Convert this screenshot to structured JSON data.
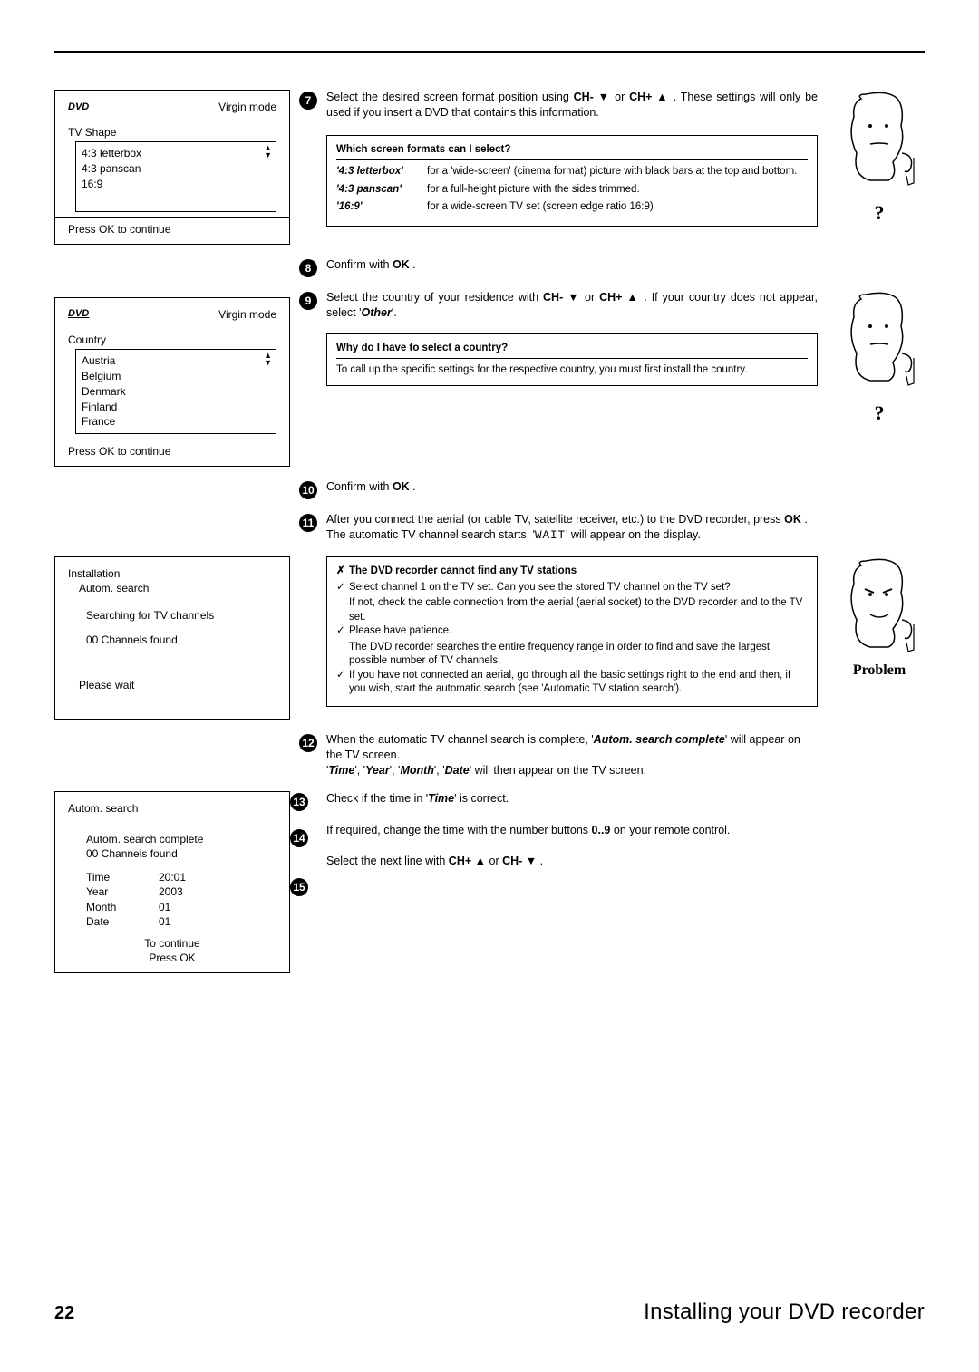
{
  "page_number": "22",
  "section_title": "Installing your DVD recorder",
  "osd1": {
    "mode": "Virgin mode",
    "heading": "TV Shape",
    "options": [
      "4:3 letterbox",
      "4:3 panscan",
      "16:9"
    ],
    "footer": "Press OK to continue"
  },
  "osd2": {
    "mode": "Virgin mode",
    "heading": "Country",
    "options": [
      "Austria",
      "Belgium",
      "Denmark",
      "Finland",
      "France"
    ],
    "footer": "Press OK to continue"
  },
  "osd3": {
    "title": "Installation",
    "subtitle": "Autom. search",
    "line1": "Searching for TV channels",
    "line2": "00 Channels found",
    "line3": "Please wait"
  },
  "osd4": {
    "title": "Autom. search",
    "line1": "Autom. search complete",
    "line2": "00 Channels found",
    "kv": [
      {
        "k": "Time",
        "v": "20:01"
      },
      {
        "k": "Year",
        "v": "2003"
      },
      {
        "k": "Month",
        "v": "01"
      },
      {
        "k": "Date",
        "v": "01"
      }
    ],
    "footer1": "To continue",
    "footer2": "Press OK"
  },
  "step7": {
    "num": "7",
    "text_a": "Select the desired screen format position using ",
    "btn_chm": "CH-",
    "or": " or ",
    "btn_chp": "CH+",
    "text_b": " . These settings will only be used if you insert a DVD that contains this information."
  },
  "info_formats": {
    "title": "Which screen formats can I select?",
    "rows": [
      {
        "term": "4:3 letterbox",
        "desc": "for a 'wide-screen' (cinema format) picture with black bars at the top and bottom."
      },
      {
        "term": "4:3 panscan",
        "desc": "for a full-height picture with the sides trimmed."
      },
      {
        "term": "16:9",
        "desc": "for a wide-screen TV set (screen edge ratio 16:9)"
      }
    ]
  },
  "step8": {
    "num": "8",
    "text_a": "Confirm with ",
    "btn": "OK",
    "text_b": " ."
  },
  "step9": {
    "num": "9",
    "text_a": "Select the country of your residence with ",
    "btn_chm": "CH-",
    "or": " or ",
    "btn_chp": "CH+",
    "text_b": " . If your country does not appear, select '",
    "other": "Other",
    "text_c": "'."
  },
  "info_country": {
    "title": "Why do I have to select a country?",
    "body": "To call up the specific settings for the respective country, you must first install the country."
  },
  "step10": {
    "num": "10",
    "text_a": "Confirm with ",
    "btn": "OK",
    "text_b": " ."
  },
  "step11": {
    "num": "11",
    "text_a": "After you connect the aerial (or cable TV, satellite receiver, etc.) to the DVD recorder, press ",
    "btn": "OK",
    "text_b": " .",
    "text_c": "The automatic TV channel search starts. '",
    "wait": "WAIT",
    "text_d": "' will appear on the display."
  },
  "info_problem": {
    "title": "The DVD recorder cannot find any TV stations",
    "tip1": "Select channel 1 on the TV set. Can you see the stored TV channel on the TV set?",
    "tip1b": "If not, check the cable connection from the aerial (aerial socket) to the DVD recorder and to the TV set.",
    "tip2": "Please have patience.",
    "tip2b": "The DVD recorder searches the entire frequency range in order to find and save the largest possible number of TV channels.",
    "tip3": "If you have not connected an aerial, go through all the basic settings right to the end and then, if you wish, start the automatic search (see 'Automatic TV station search').",
    "label": "Problem"
  },
  "step12": {
    "num": "12",
    "text_a": "When the automatic TV channel search is complete, '",
    "bold1": "Autom. search complete",
    "text_b": "' will appear on the TV screen.",
    "text_c": "'",
    "b1": "Time",
    "c1": "', '",
    "b2": "Year",
    "c2": "', '",
    "b3": "Month",
    "c3": "', '",
    "b4": "Date",
    "text_d": "' will then appear on the TV screen."
  },
  "step13": {
    "num": "13",
    "text_a": "Check if the time in '",
    "bold": "Time",
    "text_b": "' is correct."
  },
  "step14": {
    "num": "14",
    "text_a": "If required, change the time with the number buttons ",
    "btn": "0..9",
    "text_b": " on your remote control."
  },
  "step15": {
    "num": "15",
    "text_a": "Select the next line with ",
    "btn_chp": "CH+",
    "or": " or ",
    "btn_chm": "CH-",
    "text_b": " ."
  },
  "qmark": "?"
}
